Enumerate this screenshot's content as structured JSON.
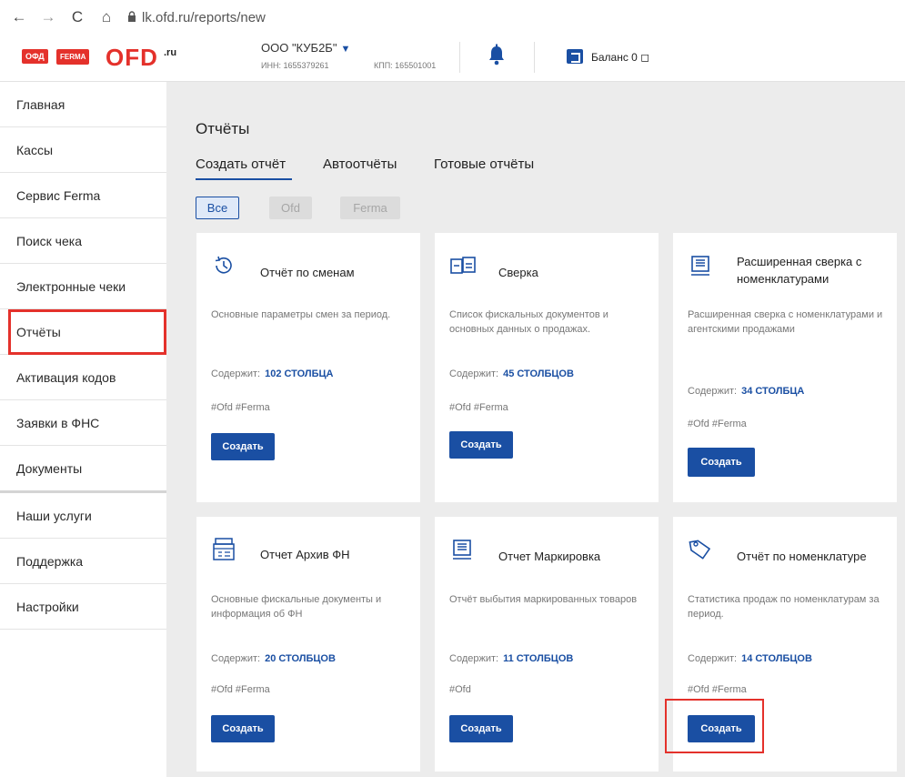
{
  "browser": {
    "back": "←",
    "forward": "→",
    "reload": "C",
    "home": "⌂",
    "url": "lk.ofd.ru/reports/new"
  },
  "header": {
    "logo_ofd": "ОФД",
    "logo_ferma": "FERMA",
    "logo_main": "OFD",
    "logo_suffix": ".ru",
    "org_name": "ООО \"КУБ2Б\"",
    "inn": "ИНН: 1655379261",
    "kpp": "КПП: 165501001",
    "balance": "Баланс 0 ◻"
  },
  "sidebar": {
    "items": [
      {
        "label": "Главная"
      },
      {
        "label": "Кассы"
      },
      {
        "label": "Сервис Ferma"
      },
      {
        "label": "Поиск чека"
      },
      {
        "label": "Электронные чеки"
      },
      {
        "label": "Отчёты"
      },
      {
        "label": "Активация кодов"
      },
      {
        "label": "Заявки в ФНС"
      },
      {
        "label": "Документы"
      },
      {
        "label": "Наши услуги"
      },
      {
        "label": "Поддержка"
      },
      {
        "label": "Настройки"
      }
    ],
    "active_index": 5
  },
  "main": {
    "title": "Отчёты",
    "tabs": [
      {
        "label": "Создать отчёт"
      },
      {
        "label": "Автоотчёты"
      },
      {
        "label": "Готовые отчёты"
      }
    ],
    "filters": [
      {
        "label": "Все"
      },
      {
        "label": "Ofd"
      },
      {
        "label": "Ferma"
      }
    ],
    "contains_label": "Содержит:",
    "create_label": "Создать",
    "cards": [
      {
        "title": "Отчёт по сменам",
        "desc": "Основные параметры смен за период.",
        "count": "102 СТОЛБЦА",
        "tags": "#Ofd #Ferma",
        "icon": "clock-report-icon"
      },
      {
        "title": "Сверка",
        "desc": "Список фискальных документов и основных данных о продажах.",
        "count": "45 СТОЛБЦОВ",
        "tags": "#Ofd #Ferma",
        "icon": "compare-documents-icon"
      },
      {
        "title": "Расширенная сверка с номенклатурами",
        "desc": "Расширенная сверка с номенклатурами и агентскими продажами",
        "count": "34 СТОЛБЦА",
        "tags": "#Ofd #Ferma",
        "icon": "monitor-list-icon"
      },
      {
        "title": "Отчет Архив ФН",
        "desc": "Основные фискальные документы и информация об ФН",
        "count": "20 СТОЛБЦОВ",
        "tags": "#Ofd #Ferma",
        "icon": "archive-icon"
      },
      {
        "title": "Отчет Маркировка",
        "desc": "Отчёт выбытия маркированных товаров",
        "count": "11 СТОЛБЦОВ",
        "tags": "#Ofd",
        "icon": "monitor-list-icon"
      },
      {
        "title": "Отчёт по номенклатуре",
        "desc": "Статистика продаж по номенклатурам за период.",
        "count": "14 СТОЛБЦОВ",
        "tags": "#Ofd #Ferma",
        "icon": "price-tag-icon"
      }
    ]
  },
  "colors": {
    "accent": "#1a4fa3",
    "brand_red": "#e4312b",
    "content_bg": "#ececec"
  }
}
